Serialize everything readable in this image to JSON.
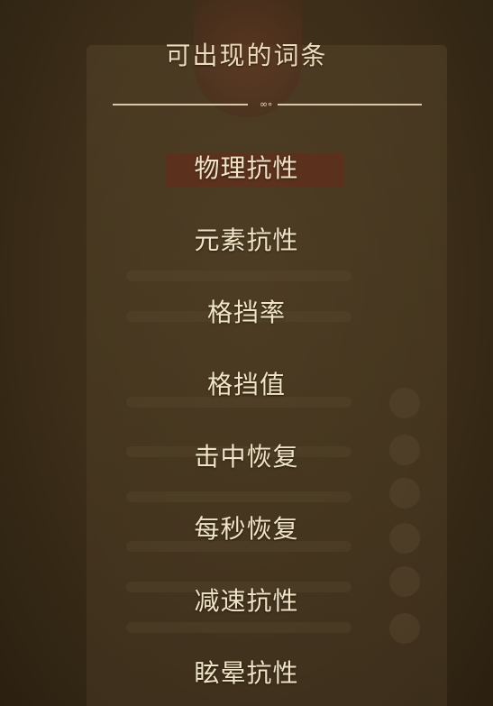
{
  "panel": {
    "title": "可出现的词条",
    "entries": [
      "物理抗性",
      "元素抗性",
      "格挡率",
      "格挡值",
      "击中恢复",
      "每秒恢复",
      "减速抗性",
      "眩晕抗性"
    ]
  },
  "colors": {
    "text": "#f1e4c6",
    "divider": "#d9c8a6",
    "overlay_bg": "#3b2d18"
  }
}
